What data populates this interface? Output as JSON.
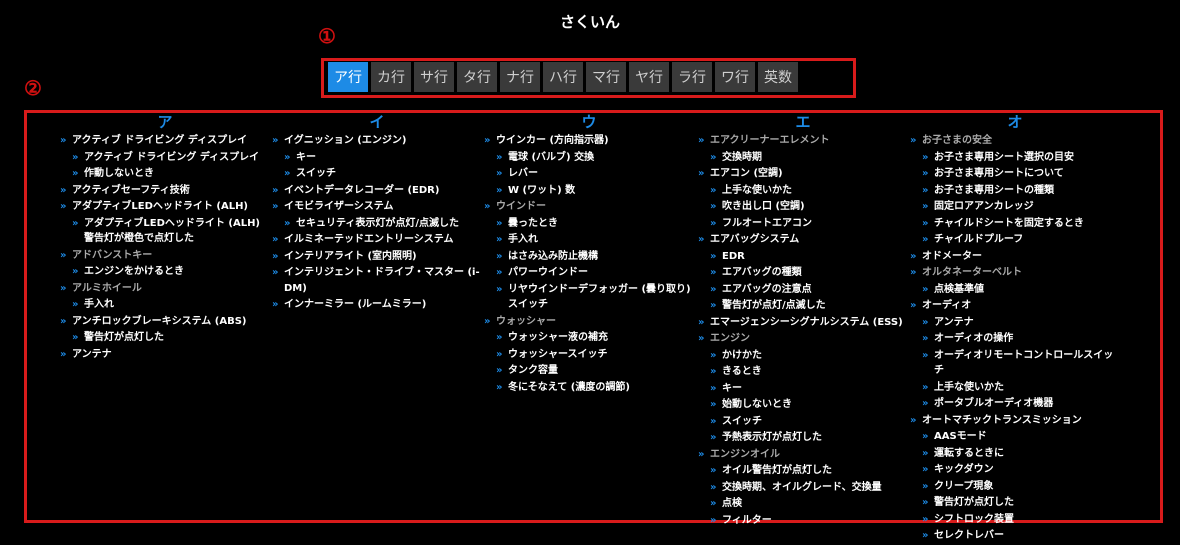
{
  "title": "さくいん",
  "callouts": {
    "one": "①",
    "two": "②"
  },
  "tabs": [
    {
      "label": "ア行",
      "active": true
    },
    {
      "label": "カ行"
    },
    {
      "label": "サ行"
    },
    {
      "label": "タ行"
    },
    {
      "label": "ナ行"
    },
    {
      "label": "ハ行"
    },
    {
      "label": "マ行"
    },
    {
      "label": "ヤ行"
    },
    {
      "label": "ラ行"
    },
    {
      "label": "ワ行"
    },
    {
      "label": "英数"
    }
  ],
  "chevron": "»",
  "columns": [
    {
      "heading": "ア",
      "items": [
        {
          "text": "アクティブ ドライビング ディスプレイ",
          "level": 0
        },
        {
          "text": "アクティブ ドライビング ディスプレイ",
          "level": 1
        },
        {
          "text": "作動しないとき",
          "level": 1
        },
        {
          "text": "アクティブセーフティ技術",
          "level": 0
        },
        {
          "text": "アダプティブLEDヘッドライト (ALH)",
          "level": 0
        },
        {
          "text": "アダプティブLEDヘッドライト (ALH) 警告灯が橙色で点灯した",
          "level": 1
        },
        {
          "text": "アドバンストキー",
          "level": 0,
          "gray": true
        },
        {
          "text": "エンジンをかけるとき",
          "level": 1
        },
        {
          "text": "アルミホイール",
          "level": 0,
          "gray": true
        },
        {
          "text": "手入れ",
          "level": 1
        },
        {
          "text": "アンチロックブレーキシステム (ABS)",
          "level": 0
        },
        {
          "text": "警告灯が点灯した",
          "level": 1
        },
        {
          "text": "アンテナ",
          "level": 0
        }
      ]
    },
    {
      "heading": "イ",
      "items": [
        {
          "text": "イグニッション (エンジン)",
          "level": 0
        },
        {
          "text": "キー",
          "level": 1
        },
        {
          "text": "スイッチ",
          "level": 1
        },
        {
          "text": "イベントデータレコーダー (EDR)",
          "level": 0
        },
        {
          "text": "イモビライザーシステム",
          "level": 0
        },
        {
          "text": "セキュリティ表示灯が点灯/点滅した",
          "level": 1
        },
        {
          "text": "イルミネーテッドエントリーシステム",
          "level": 0
        },
        {
          "text": "インテリアライト (室内照明)",
          "level": 0
        },
        {
          "text": "インテリジェント・ドライブ・マスター (i-DM)",
          "level": 0
        },
        {
          "text": "インナーミラー (ルームミラー)",
          "level": 0
        }
      ]
    },
    {
      "heading": "ウ",
      "items": [
        {
          "text": "ウインカー (方向指示器)",
          "level": 0
        },
        {
          "text": "電球 (バルブ) 交換",
          "level": 1
        },
        {
          "text": "レバー",
          "level": 1
        },
        {
          "text": "W (ワット) 数",
          "level": 1
        },
        {
          "text": "ウインドー",
          "level": 0,
          "gray": true
        },
        {
          "text": "曇ったとき",
          "level": 1
        },
        {
          "text": "手入れ",
          "level": 1
        },
        {
          "text": "はさみ込み防止機構",
          "level": 1
        },
        {
          "text": "パワーウインドー",
          "level": 1
        },
        {
          "text": "リヤウインドーデフォッガー (曇り取り) スイッチ",
          "level": 1
        },
        {
          "text": "ウォッシャー",
          "level": 0,
          "gray": true
        },
        {
          "text": "ウォッシャー液の補充",
          "level": 1
        },
        {
          "text": "ウォッシャースイッチ",
          "level": 1
        },
        {
          "text": "タンク容量",
          "level": 1
        },
        {
          "text": "冬にそなえて (濃度の調節)",
          "level": 1
        }
      ]
    },
    {
      "heading": "エ",
      "items": [
        {
          "text": "エアクリーナーエレメント",
          "level": 0,
          "gray": true
        },
        {
          "text": "交換時期",
          "level": 1
        },
        {
          "text": "エアコン (空調)",
          "level": 0
        },
        {
          "text": "上手な使いかた",
          "level": 1
        },
        {
          "text": "吹き出し口 (空調)",
          "level": 1
        },
        {
          "text": "フルオートエアコン",
          "level": 1
        },
        {
          "text": "エアバッグシステム",
          "level": 0
        },
        {
          "text": "EDR",
          "level": 1
        },
        {
          "text": "エアバッグの種類",
          "level": 1
        },
        {
          "text": "エアバッグの注意点",
          "level": 1
        },
        {
          "text": "警告灯が点灯/点滅した",
          "level": 1
        },
        {
          "text": "エマージェンシーシグナルシステム (ESS)",
          "level": 0
        },
        {
          "text": "エンジン",
          "level": 0,
          "gray": true
        },
        {
          "text": "かけかた",
          "level": 1
        },
        {
          "text": "きるとき",
          "level": 1
        },
        {
          "text": "キー",
          "level": 1
        },
        {
          "text": "始動しないとき",
          "level": 1
        },
        {
          "text": "スイッチ",
          "level": 1
        },
        {
          "text": "予熱表示灯が点灯した",
          "level": 1
        },
        {
          "text": "エンジンオイル",
          "level": 0,
          "gray": true
        },
        {
          "text": "オイル警告灯が点灯した",
          "level": 1
        },
        {
          "text": "交換時期、オイルグレード、交換量",
          "level": 1
        },
        {
          "text": "点検",
          "level": 1
        },
        {
          "text": "フィルター",
          "level": 1
        }
      ]
    },
    {
      "heading": "オ",
      "items": [
        {
          "text": "お子さまの安全",
          "level": 0,
          "gray": true
        },
        {
          "text": "お子さま専用シート選択の目安",
          "level": 1
        },
        {
          "text": "お子さま専用シートについて",
          "level": 1
        },
        {
          "text": "お子さま専用シートの種類",
          "level": 1
        },
        {
          "text": "固定ロアアンカレッジ",
          "level": 1
        },
        {
          "text": "チャイルドシートを固定するとき",
          "level": 1
        },
        {
          "text": "チャイルドプルーフ",
          "level": 1
        },
        {
          "text": "オドメーター",
          "level": 0
        },
        {
          "text": "オルタネーターベルト",
          "level": 0,
          "gray": true
        },
        {
          "text": "点検基準値",
          "level": 1
        },
        {
          "text": "オーディオ",
          "level": 0
        },
        {
          "text": "アンテナ",
          "level": 1
        },
        {
          "text": "オーディオの操作",
          "level": 1
        },
        {
          "text": "オーディオリモートコントロールスイッチ",
          "level": 1
        },
        {
          "text": "上手な使いかた",
          "level": 1
        },
        {
          "text": "ポータブルオーディオ機器",
          "level": 1
        },
        {
          "text": "オートマチックトランスミッション",
          "level": 0
        },
        {
          "text": "AASモード",
          "level": 1
        },
        {
          "text": "運転するときに",
          "level": 1
        },
        {
          "text": "キックダウン",
          "level": 1
        },
        {
          "text": "クリープ現象",
          "level": 1
        },
        {
          "text": "警告灯が点灯した",
          "level": 1
        },
        {
          "text": "シフトロック装置",
          "level": 1
        },
        {
          "text": "セレクトレバー",
          "level": 1
        }
      ]
    }
  ]
}
